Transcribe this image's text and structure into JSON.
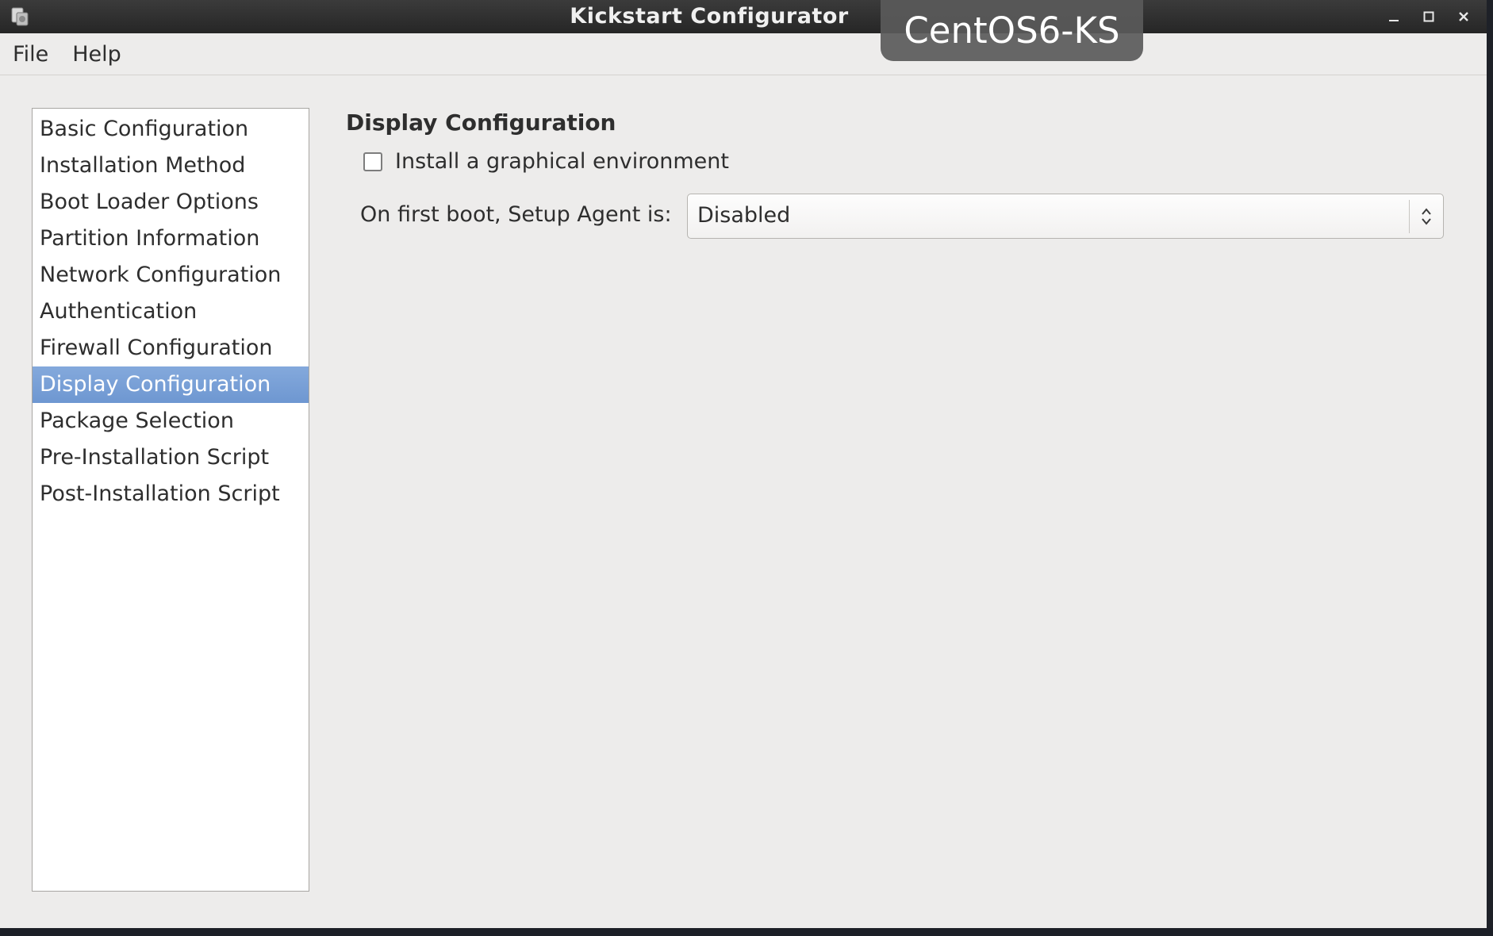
{
  "window": {
    "title": "Kickstart Configurator",
    "host_label": "CentOS6-KS",
    "controls": [
      "minimize-icon",
      "maximize-icon",
      "close-icon"
    ]
  },
  "menu": {
    "items": [
      "File",
      "Help"
    ]
  },
  "sidebar": {
    "selected_index": 7,
    "items": [
      {
        "label": "Basic Configuration"
      },
      {
        "label": "Installation Method"
      },
      {
        "label": "Boot Loader Options"
      },
      {
        "label": "Partition Information"
      },
      {
        "label": "Network Configuration"
      },
      {
        "label": "Authentication"
      },
      {
        "label": "Firewall Configuration"
      },
      {
        "label": "Display Configuration"
      },
      {
        "label": "Package Selection"
      },
      {
        "label": "Pre-Installation Script"
      },
      {
        "label": "Post-Installation Script"
      }
    ]
  },
  "main": {
    "section_title": "Display Configuration",
    "graphical_checkbox": {
      "label": "Install a graphical environment",
      "checked": false
    },
    "setup_agent": {
      "label": "On first boot, Setup Agent is:",
      "value": "Disabled"
    }
  },
  "colors": {
    "selection": "#7ba0d8",
    "titlebar": "#2f2f2f",
    "background": "#edeceb"
  }
}
